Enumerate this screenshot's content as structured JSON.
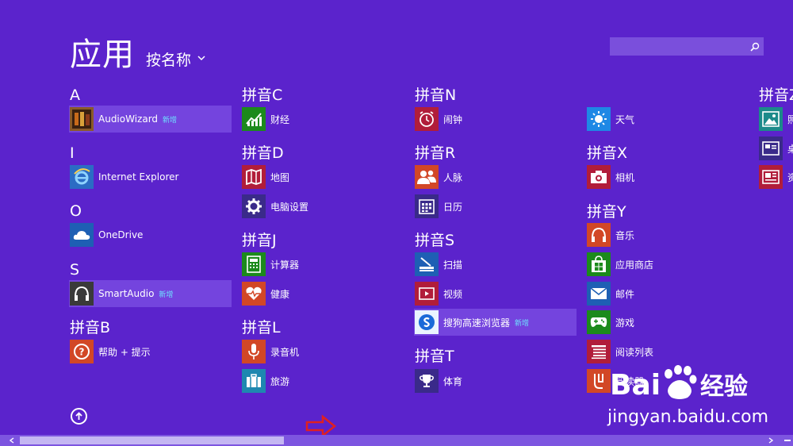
{
  "header": {
    "title": "应用",
    "sort_label": "按名称"
  },
  "search": {
    "placeholder": ""
  },
  "groups": {
    "A": "A",
    "I": "I",
    "O": "O",
    "S": "S",
    "B": "拼音B",
    "C": "拼音C",
    "D": "拼音D",
    "J": "拼音J",
    "L": "拼音L",
    "N": "拼音N",
    "R": "拼音R",
    "PS": "拼音S",
    "T": "拼音T",
    "X": "拼音X",
    "Y": "拼音Y",
    "Z": "拼音Z"
  },
  "apps": {
    "audiowizard": {
      "label": "AudioWizard",
      "badge": "新增"
    },
    "ie": {
      "label": "Internet Explorer"
    },
    "onedrive": {
      "label": "OneDrive"
    },
    "smartaudio": {
      "label": "SmartAudio",
      "badge": "新增"
    },
    "help": {
      "label": "帮助 + 提示"
    },
    "finance": {
      "label": "财经"
    },
    "maps": {
      "label": "地图"
    },
    "pcsettings": {
      "label": "电脑设置"
    },
    "calculator": {
      "label": "计算器"
    },
    "health": {
      "label": "健康"
    },
    "recorder": {
      "label": "录音机"
    },
    "travel": {
      "label": "旅游"
    },
    "alarm": {
      "label": "闹钟"
    },
    "people": {
      "label": "人脉"
    },
    "calendar": {
      "label": "日历"
    },
    "scan": {
      "label": "扫描"
    },
    "video": {
      "label": "视频"
    },
    "sogou": {
      "label": "搜狗高速浏览器",
      "badge": "新增"
    },
    "sports": {
      "label": "体育"
    },
    "weather": {
      "label": "天气"
    },
    "camera": {
      "label": "相机"
    },
    "music": {
      "label": "音乐"
    },
    "store": {
      "label": "应用商店"
    },
    "mail": {
      "label": "邮件"
    },
    "games": {
      "label": "游戏"
    },
    "readinglist": {
      "label": "阅读列表"
    },
    "reader": {
      "label": "阅读器"
    },
    "photos": {
      "label": "照"
    },
    "desktop": {
      "label": "桌"
    },
    "news": {
      "label": "资"
    }
  },
  "watermark": {
    "brand": "Bai",
    "brand2": "经验",
    "url": "jingyan.baidu.com"
  },
  "colors": {
    "background": "#5b23cc",
    "highlight": "#7444de",
    "badge": "#6ee0ff",
    "tile_orange": "#d24726",
    "tile_red": "#b11d3a",
    "tile_green": "#1c8a1c",
    "tile_blue": "#2b5797",
    "tile_dark": "#3a2a8a",
    "arrow_annotation": "#e02020"
  }
}
